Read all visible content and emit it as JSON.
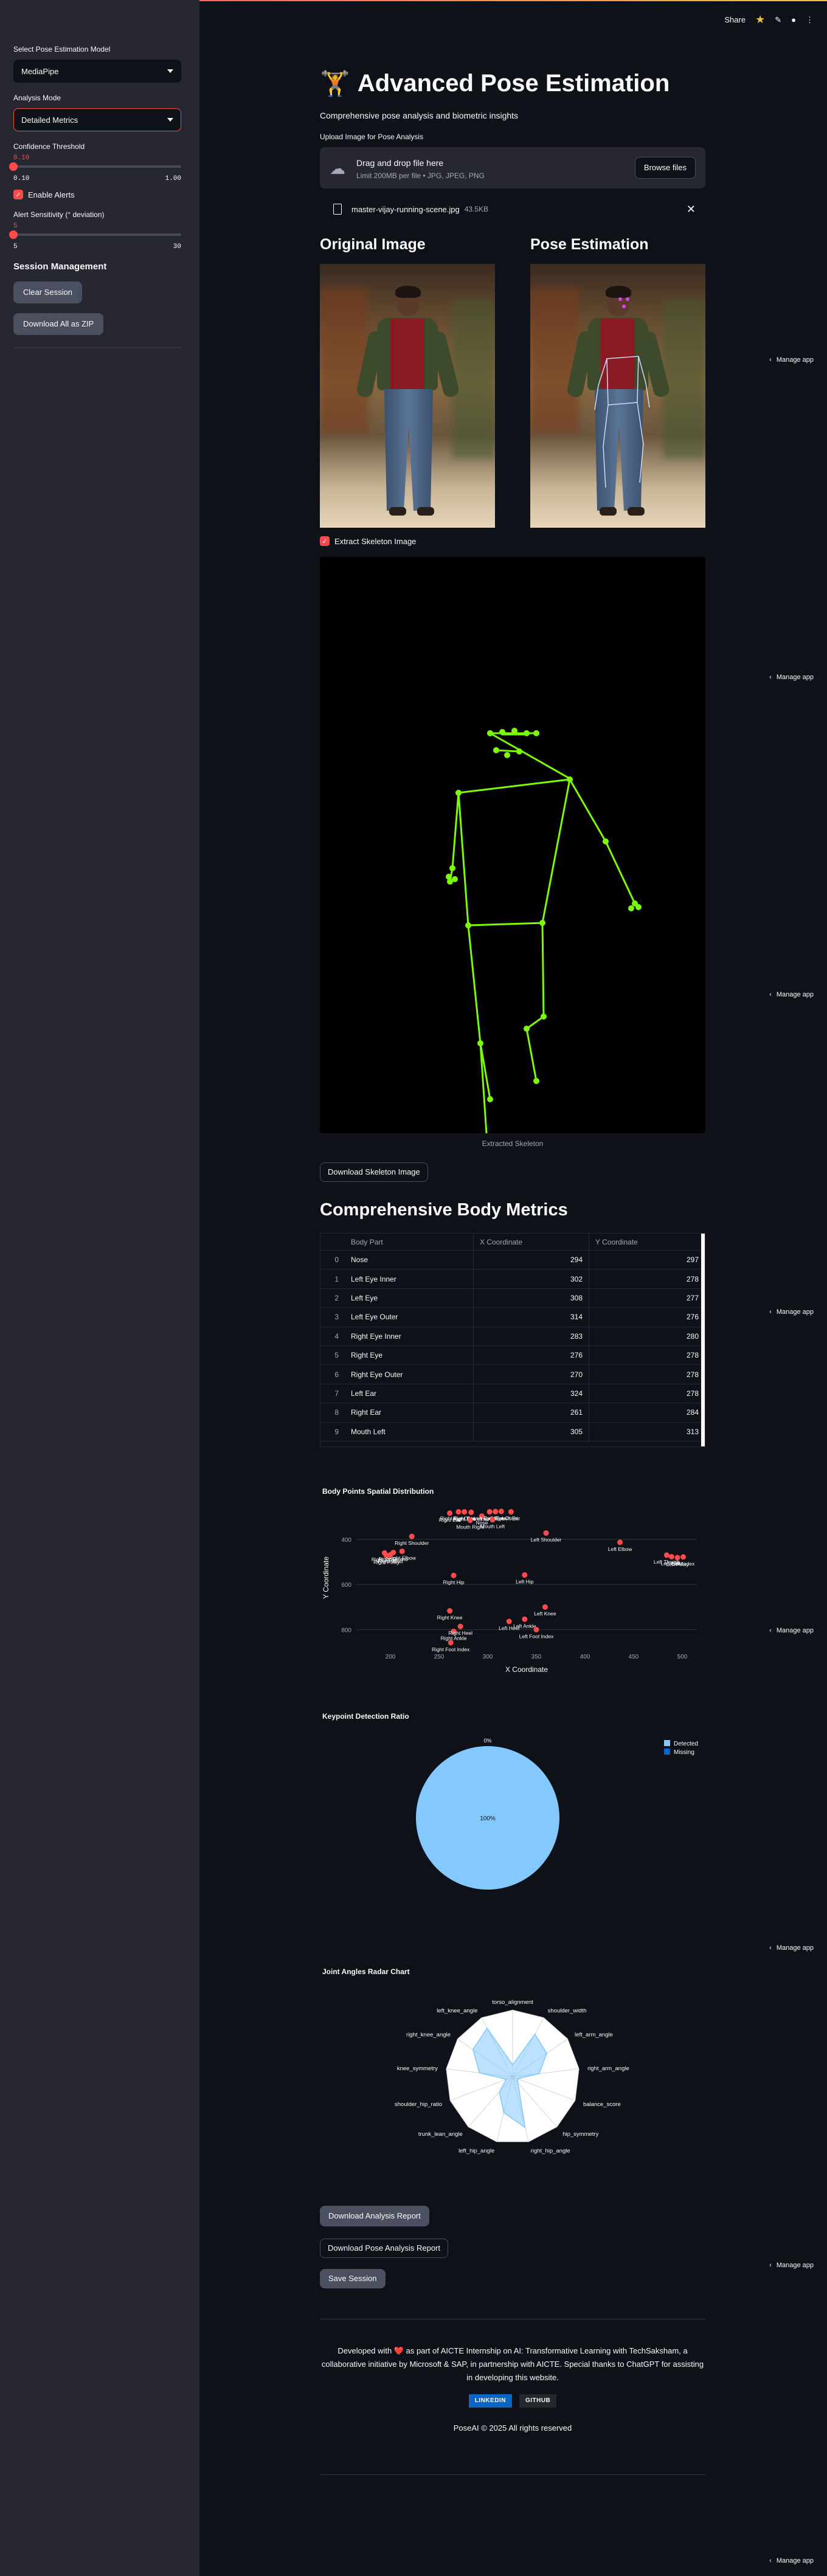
{
  "sidebar": {
    "model_label": "Select Pose Estimation Model",
    "model_value": "MediaPipe",
    "mode_label": "Analysis Mode",
    "mode_value": "Detailed Metrics",
    "confidence_label": "Confidence Threshold",
    "confidence_value": "0.10",
    "confidence_min": "0.10",
    "confidence_max": "1.00",
    "confidence_fraction": 0,
    "enable_alerts_label": "Enable Alerts",
    "alert_sensitivity_label": "Alert Sensitivity (° deviation)",
    "alert_value": "5",
    "alert_min": "5",
    "alert_max": "30",
    "alert_fraction": 0,
    "session_heading": "Session Management",
    "clear_session": "Clear Session",
    "download_all_zip": "Download All as ZIP"
  },
  "header": {
    "share": "Share",
    "icons": [
      "star-icon",
      "edit-icon",
      "github-icon",
      "more-icon"
    ]
  },
  "main": {
    "title": "Advanced Pose Estimation",
    "title_icon": "🏋️",
    "subtitle": "Comprehensive pose analysis and biometric insights",
    "upload_label": "Upload Image for Pose Analysis",
    "dropzone_title": "Drag and drop file here",
    "dropzone_hint": "Limit 200MB per file • JPG, JPEG, PNG",
    "browse": "Browse files",
    "file_name": "master-vijay-running-scene.jpg",
    "file_size": "43.5KB",
    "original_title": "Original Image",
    "pose_title": "Pose Estimation",
    "extract_skeleton_label": "Extract Skeleton Image",
    "skeleton_caption": "Extracted Skeleton",
    "download_skeleton": "Download Skeleton Image",
    "metrics_title": "Comprehensive Body Metrics"
  },
  "table": {
    "headers": [
      "",
      "Body Part",
      "X Coordinate",
      "Y Coordinate"
    ],
    "rows": [
      {
        "idx": "0",
        "part": "Nose",
        "x": "294",
        "y": "297"
      },
      {
        "idx": "1",
        "part": "Left Eye Inner",
        "x": "302",
        "y": "278"
      },
      {
        "idx": "2",
        "part": "Left Eye",
        "x": "308",
        "y": "277"
      },
      {
        "idx": "3",
        "part": "Left Eye Outer",
        "x": "314",
        "y": "276"
      },
      {
        "idx": "4",
        "part": "Right Eye Inner",
        "x": "283",
        "y": "280"
      },
      {
        "idx": "5",
        "part": "Right Eye",
        "x": "276",
        "y": "278"
      },
      {
        "idx": "6",
        "part": "Right Eye Outer",
        "x": "270",
        "y": "278"
      },
      {
        "idx": "7",
        "part": "Left Ear",
        "x": "324",
        "y": "278"
      },
      {
        "idx": "8",
        "part": "Right Ear",
        "x": "261",
        "y": "284"
      },
      {
        "idx": "9",
        "part": "Mouth Left",
        "x": "305",
        "y": "313"
      }
    ]
  },
  "charts": {
    "scatter_title": "Body Points Spatial Distribution",
    "pie_title": "Keypoint Detection Ratio",
    "radar_title": "Joint Angles Radar Chart"
  },
  "chart_data": [
    {
      "type": "scatter",
      "title": "Body Points Spatial Distribution",
      "xlabel": "X Coordinate",
      "ylabel": "Y Coordinate",
      "xlim": [
        165,
        515
      ],
      "ylim": [
        880,
        260
      ],
      "xticks": [
        "200",
        "300",
        "400",
        "500"
      ],
      "xticks_extra": [
        "250",
        "350",
        "450"
      ],
      "yticks": [
        "400",
        "600",
        "800"
      ],
      "color": "#ff4b4b",
      "points": [
        {
          "label": "Nose",
          "x": 294,
          "y": 297
        },
        {
          "label": "Left Eye Inner",
          "x": 302,
          "y": 278
        },
        {
          "label": "Left Eye",
          "x": 308,
          "y": 277
        },
        {
          "label": "Left Eye Outer",
          "x": 314,
          "y": 276
        },
        {
          "label": "Right Eye Inner",
          "x": 283,
          "y": 280
        },
        {
          "label": "Right Eye",
          "x": 276,
          "y": 278
        },
        {
          "label": "Right Eye Outer",
          "x": 270,
          "y": 278
        },
        {
          "label": "Left Ear",
          "x": 324,
          "y": 278
        },
        {
          "label": "Right Ear",
          "x": 261,
          "y": 284
        },
        {
          "label": "Mouth Left",
          "x": 305,
          "y": 313
        },
        {
          "label": "Mouth Right",
          "x": 282,
          "y": 315
        },
        {
          "label": "Left Shoulder",
          "x": 360,
          "y": 372
        },
        {
          "label": "Right Shoulder",
          "x": 222,
          "y": 387
        },
        {
          "label": "Left Elbow",
          "x": 436,
          "y": 413
        },
        {
          "label": "Right Elbow",
          "x": 212,
          "y": 453
        },
        {
          "label": "Left Wrist",
          "x": 489,
          "y": 477
        },
        {
          "label": "Right Wrist",
          "x": 200,
          "y": 468
        },
        {
          "label": "Left Pinky",
          "x": 495,
          "y": 481
        },
        {
          "label": "Right Pinky",
          "x": 196,
          "y": 472
        },
        {
          "label": "Left Index",
          "x": 501,
          "y": 478
        },
        {
          "label": "Right Index",
          "x": 194,
          "y": 460
        },
        {
          "label": "Left Thumb",
          "x": 484,
          "y": 470
        },
        {
          "label": "Right Thumb",
          "x": 203,
          "y": 458
        },
        {
          "label": "Left Hip",
          "x": 338,
          "y": 558
        },
        {
          "label": "Right Hip",
          "x": 265,
          "y": 560
        },
        {
          "label": "Left Knee",
          "x": 359,
          "y": 700
        },
        {
          "label": "Right Knee",
          "x": 261,
          "y": 717
        },
        {
          "label": "Left Ankle",
          "x": 338,
          "y": 754
        },
        {
          "label": "Right Ankle",
          "x": 265,
          "y": 808
        },
        {
          "label": "Left Heel",
          "x": 322,
          "y": 764
        },
        {
          "label": "Right Heel",
          "x": 272,
          "y": 786
        },
        {
          "label": "Left Foot Index",
          "x": 350,
          "y": 800
        },
        {
          "label": "Right Foot Index",
          "x": 262,
          "y": 858
        }
      ]
    },
    {
      "type": "pie",
      "title": "Keypoint Detection Ratio",
      "series": [
        {
          "name": "Detected",
          "value": 100,
          "color": "#83c9ff",
          "label": "100%"
        },
        {
          "name": "Missing",
          "value": 0,
          "color": "#0068c9",
          "label": "0%"
        }
      ]
    },
    {
      "type": "radar",
      "title": "Joint Angles Radar Chart",
      "axes": [
        "torso_alignment",
        "shoulder_width",
        "left_arm_angle",
        "right_arm_angle",
        "balance_score",
        "hip_symmetry",
        "right_hip_angle",
        "left_hip_angle",
        "trunk_lean_angle",
        "shoulder_hip_ratio",
        "knee_symmetry",
        "right_knee_angle",
        "left_knee_angle"
      ],
      "values": [
        0.18,
        0.72,
        0.62,
        0.4,
        0.08,
        0.12,
        0.78,
        0.55,
        0.3,
        0.1,
        0.5,
        0.72,
        0.82
      ],
      "color": "#83c9ff"
    }
  ],
  "actions": {
    "download_report": "Download Analysis Report",
    "download_pose_report": "Download Pose Analysis Report",
    "save_session": "Save Session"
  },
  "footer": {
    "line": "Developed with ❤️ as part of AICTE Internship on AI: Transformative Learning with TechSaksham, a collaborative initiative by Microsoft & SAP, in partnership with AICTE. Special thanks to ChatGPT for assisting in developing this website.",
    "linkedin": "LINKEDIN",
    "github": "GITHUB",
    "copyright": "PoseAI © 2025 All rights reserved"
  },
  "manage_app": "Manage app"
}
